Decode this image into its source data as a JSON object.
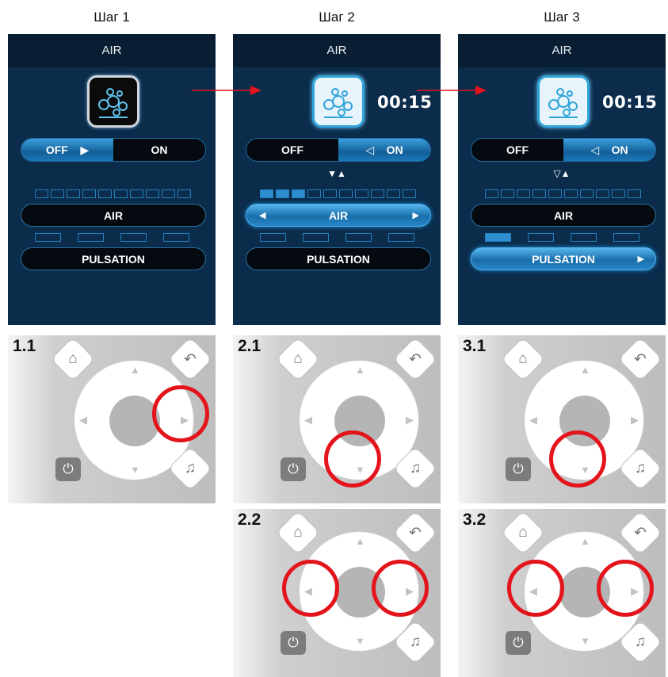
{
  "steps": [
    "Шаг 1",
    "Шаг 2",
    "Шаг 3"
  ],
  "screen": {
    "title": "AIR",
    "off": "OFF",
    "on": "ON",
    "timer": "00:15",
    "air": "AIR",
    "pulsation": "PULSATION",
    "arrows_step2": "▼▲",
    "arrows_step3": "▽▲",
    "air_level_step2": 3,
    "air_level_total": 10,
    "pulsation_level_step3": 1,
    "pulsation_level_total": 4
  },
  "remotes": {
    "r11": "1.1",
    "r21": "2.1",
    "r31": "3.1",
    "r22": "2.2",
    "r32": "3.2"
  },
  "icons": {
    "home": "⌂",
    "back": "↶",
    "music": "♫",
    "power": "⏻"
  },
  "colors": {
    "screen_bg": "#0b2c4b",
    "highlight": "#e3141b",
    "active_blue": "#2d8fd0"
  }
}
